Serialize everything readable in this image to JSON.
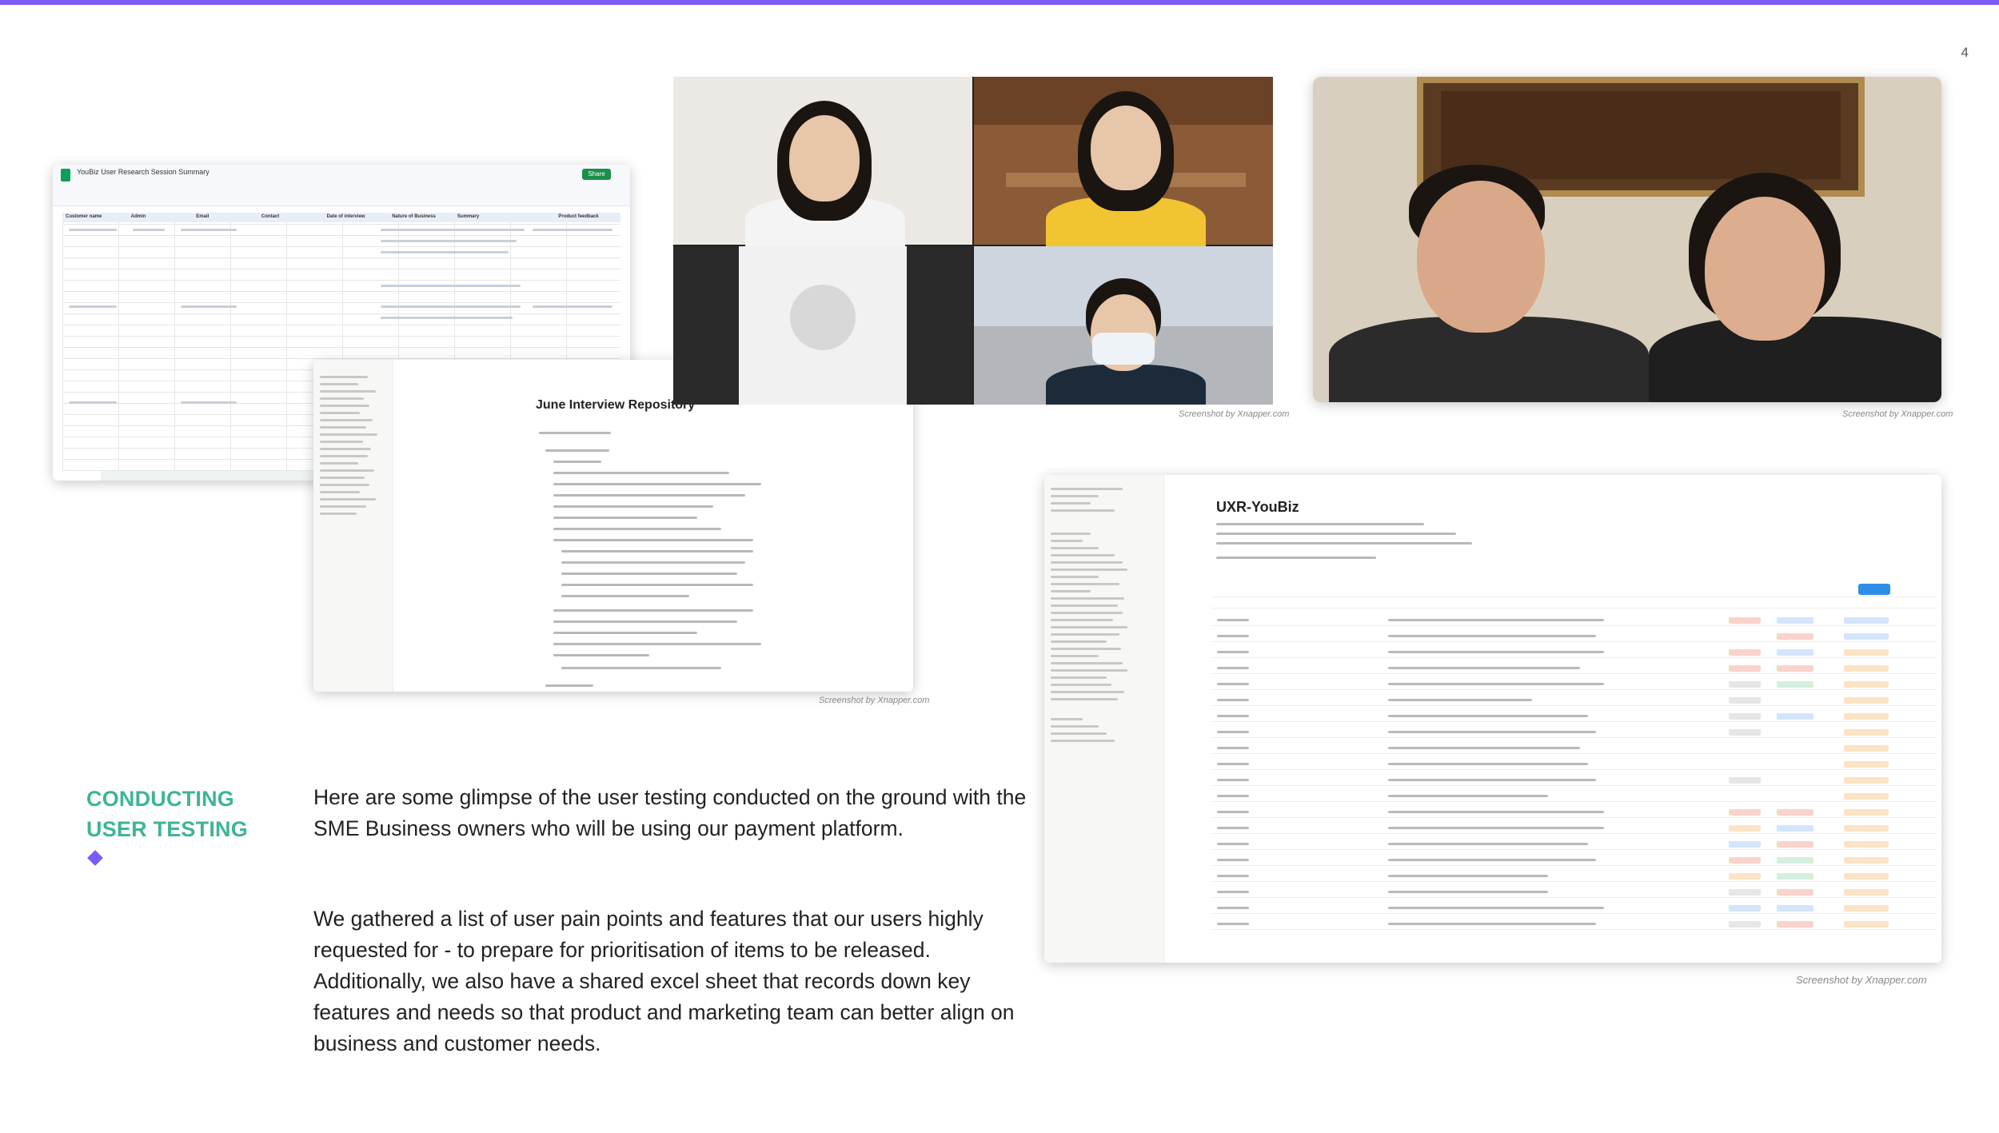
{
  "page": {
    "number": "4"
  },
  "credits": {
    "video_call": "Screenshot by Xnapper.com",
    "video_pair": "Screenshot by Xnapper.com",
    "repository": "Screenshot by Xnapper.com",
    "database": "Screenshot by Xnapper.com"
  },
  "spreadsheet": {
    "title": "YouBiz User Research Session Summary",
    "share_label": "Share",
    "columns": [
      "Customer name",
      "Admin",
      "Email",
      "Contact",
      "Date of interview",
      "Nature of Business",
      "Summary",
      "Product feedback"
    ]
  },
  "repository": {
    "title": "June Interview Repository"
  },
  "database": {
    "title": "UXR-YouBiz"
  },
  "section": {
    "title_line1": "CONDUCTING",
    "title_line2": "USER TESTING",
    "paragraph1": "Here are some glimpse of the user testing conducted on the ground with the SME Business owners who will be using our payment platform.",
    "paragraph2": "We gathered a list of user pain points and features that our users highly requested for - to prepare for prioritisation of items to be released. Additionally, we also have a shared excel sheet that records down key features and needs so that product and marketing team can better align on business and customer needs."
  },
  "colors": {
    "accent": "#7a5af8",
    "title": "#3fb497"
  }
}
